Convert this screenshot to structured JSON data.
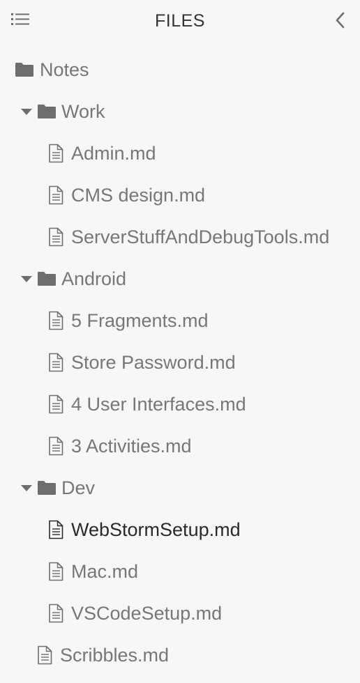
{
  "header": {
    "title": "FILES",
    "menu_icon": "list-menu-icon",
    "collapse_icon": "chevron-left-icon"
  },
  "colors": {
    "background": "#f7f7f7",
    "text": "#777777",
    "active_text": "#2a2a2a",
    "icon": "#6e6e6e"
  },
  "tree": {
    "root": {
      "label": "Notes",
      "icon": "folder-icon"
    },
    "folders": [
      {
        "label": "Work",
        "expanded": true,
        "files": [
          "Admin.md",
          "CMS design.md",
          "ServerStuffAndDebugTools.md"
        ]
      },
      {
        "label": "Android",
        "expanded": true,
        "files": [
          "5 Fragments.md",
          "Store Password.md",
          "4 User Interfaces.md",
          "3 Activities.md"
        ]
      },
      {
        "label": "Dev",
        "expanded": true,
        "files": [
          "WebStormSetup.md",
          "Mac.md",
          "VSCodeSetup.md"
        ]
      }
    ],
    "root_files": [
      "Scribbles.md"
    ],
    "active_file": "WebStormSetup.md"
  }
}
